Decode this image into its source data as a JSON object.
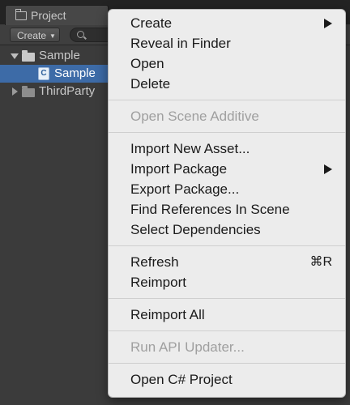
{
  "panel": {
    "tab_title": "Project",
    "create_label": "Create",
    "tree": {
      "items": [
        {
          "label": "Sample",
          "type": "folder",
          "expanded": true
        },
        {
          "label": "Sample",
          "type": "csharp-script",
          "selected": true
        },
        {
          "label": "ThirdParty",
          "type": "folder",
          "expanded": false
        }
      ]
    }
  },
  "context_menu": {
    "create": "Create",
    "reveal_in_finder": "Reveal in Finder",
    "open": "Open",
    "delete": "Delete",
    "open_scene_additive": "Open Scene Additive",
    "import_new_asset": "Import New Asset...",
    "import_package": "Import Package",
    "export_package": "Export Package...",
    "find_references_in_scene": "Find References In Scene",
    "select_dependencies": "Select Dependencies",
    "refresh": "Refresh",
    "refresh_shortcut": "⌘R",
    "reimport": "Reimport",
    "reimport_all": "Reimport All",
    "run_api_updater": "Run API Updater...",
    "open_csharp_project": "Open C# Project"
  },
  "colors": {
    "panel_background": "#3b3b3b",
    "selection": "#3d6ba7",
    "menu_background": "#ececec",
    "menu_text": "#1a1a1a",
    "menu_disabled_text": "#9f9f9f"
  }
}
